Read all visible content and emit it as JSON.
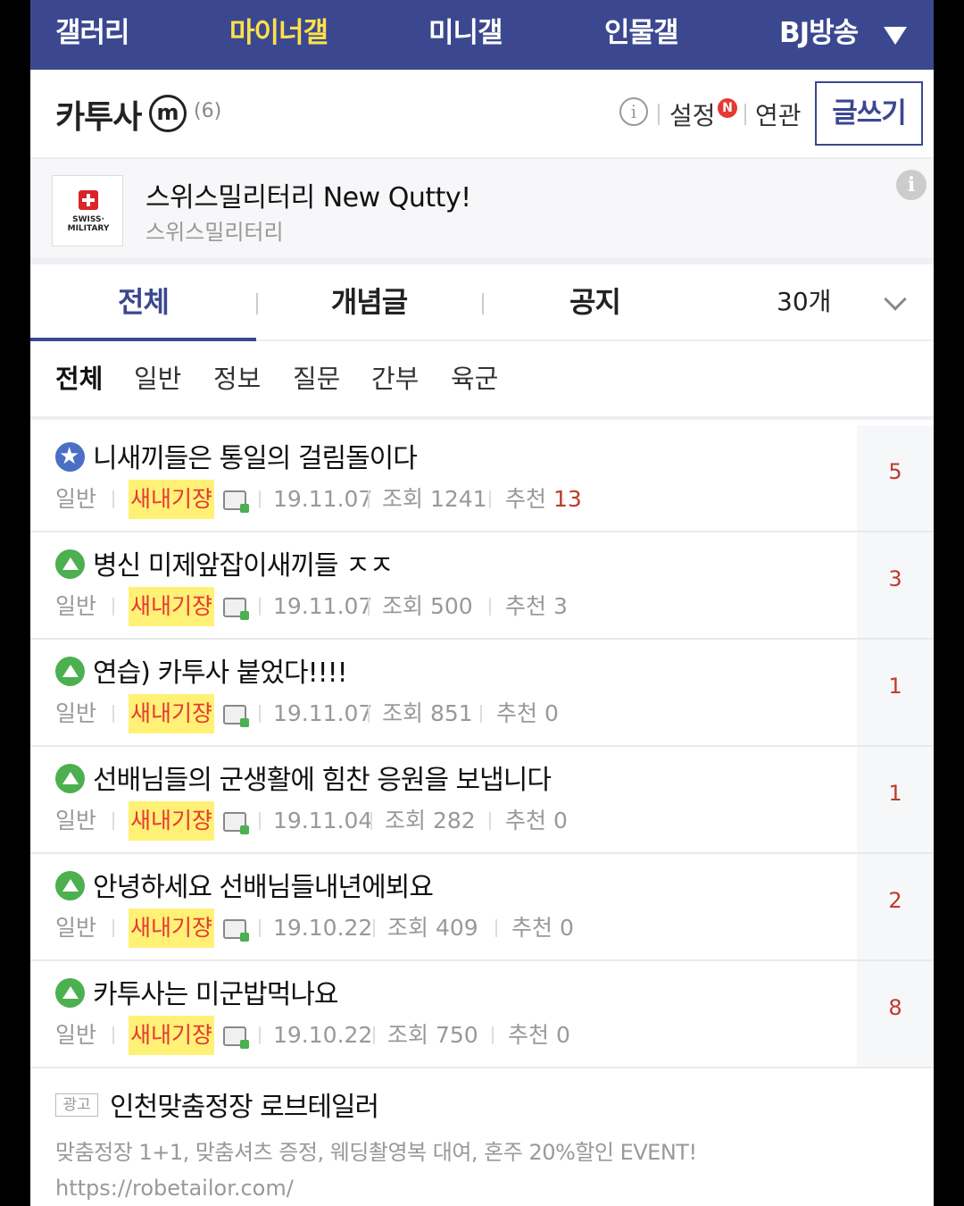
{
  "topnav": {
    "items": [
      "갤러리",
      "마이너갤",
      "미니갤",
      "인물갤",
      "BJ방송"
    ],
    "active_index": 1
  },
  "gallery": {
    "title": "카투사",
    "badge": "m",
    "count": "(6)",
    "settings_label": "설정",
    "new_badge": "N",
    "related_label": "연관",
    "write_label": "글쓰기"
  },
  "promo": {
    "logo_text": "SWISS· MILITARY",
    "title": "스위스밀리터리 New Qutty!",
    "subtitle": "스위스밀리터리"
  },
  "tabs": {
    "items": [
      "전체",
      "개념글",
      "공지"
    ],
    "active_index": 0,
    "page_size": "30개"
  },
  "categories": {
    "items": [
      "전체",
      "일반",
      "정보",
      "질문",
      "간부",
      "육군"
    ],
    "active_index": 0
  },
  "posts": [
    {
      "title": "니새끼들은 통일의 걸림돌이다",
      "category": "일반",
      "writer": "새내기쟝",
      "date": "19.11.07",
      "views": "조회 1241",
      "rec_label": "추천",
      "rec_num": "13",
      "comments": "5",
      "icon": "star"
    },
    {
      "title": "병신 미제앞잡이새끼들 ㅈㅈ",
      "category": "일반",
      "writer": "새내기쟝",
      "date": "19.11.07",
      "views": "조회 500",
      "rec_label": "추천",
      "rec_num": "3",
      "comments": "3",
      "icon": "user"
    },
    {
      "title": "연습) 카투사 붙었다!!!!",
      "category": "일반",
      "writer": "새내기쟝",
      "date": "19.11.07",
      "views": "조회 851",
      "rec_label": "추천",
      "rec_num": "0",
      "comments": "1",
      "icon": "user"
    },
    {
      "title": "선배님들의 군생활에 힘찬 응원을 보냅니다",
      "category": "일반",
      "writer": "새내기쟝",
      "date": "19.11.04",
      "views": "조회 282",
      "rec_label": "추천",
      "rec_num": "0",
      "comments": "1",
      "icon": "user"
    },
    {
      "title": "안녕하세요 선배님들내년에뵈요",
      "category": "일반",
      "writer": "새내기쟝",
      "date": "19.10.22",
      "views": "조회 409",
      "rec_label": "추천",
      "rec_num": "0",
      "comments": "2",
      "icon": "user"
    },
    {
      "title": "카투사는 미군밥먹나요",
      "category": "일반",
      "writer": "새내기쟝",
      "date": "19.10.22",
      "views": "조회 750",
      "rec_label": "추천",
      "rec_num": "0",
      "comments": "8",
      "icon": "user"
    }
  ],
  "ad": {
    "tag": "광고",
    "title": "인천맞춤정장 로브테일러",
    "desc": "맞춤정장 1+1, 맞춤셔츠 증정, 웨딩촬영복 대여, 혼주 20%할인 EVENT!",
    "url": "https://robetailor.com/"
  },
  "colors": {
    "nav_bg": "#3b4890",
    "nav_active": "#ffe14a",
    "writer_highlight": "#fff176",
    "comment_count": "#c0392b"
  }
}
